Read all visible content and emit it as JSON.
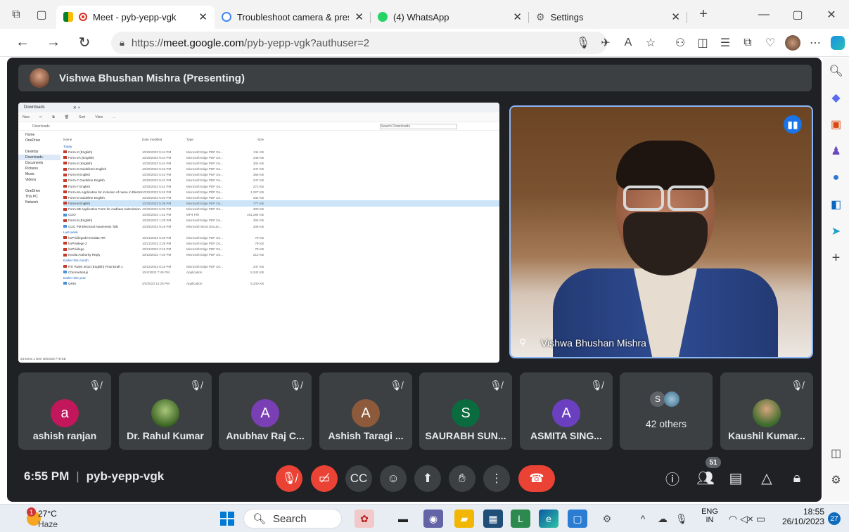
{
  "tabs": [
    {
      "title": "Meet - pyb-yepp-vgk",
      "active": true
    },
    {
      "title": "Troubleshoot camera & presenta",
      "active": false
    },
    {
      "title": "(4) WhatsApp",
      "active": false
    },
    {
      "title": "Settings",
      "active": false
    }
  ],
  "address": {
    "prefix": "https://",
    "host": "meet.google.com",
    "path": "/pyb-yepp-vgk?authuser=2"
  },
  "presenter_bar": {
    "label": "Vishwa Bhushan Mishra (Presenting)"
  },
  "shared_screen": {
    "window_title": "Downloads",
    "toolbar": [
      "New",
      "Sort",
      "View",
      "..."
    ],
    "breadcrumb": "Downloads",
    "search_placeholder": "Search Downloads",
    "sidebar": [
      "Home",
      "OneDrive",
      "",
      "Desktop",
      "Downloads",
      "Documents",
      "Pictures",
      "Music",
      "Videos",
      "",
      "OneDrive",
      "This PC",
      "Network"
    ],
    "columns": [
      "Name",
      "Date modified",
      "Type",
      "Size"
    ],
    "rows": [
      {
        "group": "Today"
      },
      {
        "name": "Form-2 (English)",
        "date": "10/26/2023 5:44 PM",
        "type": "Microsoft Edge PDF Do...",
        "size": "311 KB"
      },
      {
        "name": "Form-2A (English)",
        "date": "10/26/2023 5:44 PM",
        "type": "Microsoft Edge PDF Do...",
        "size": "345 KB"
      },
      {
        "name": "Form-2 (English)",
        "date": "10/26/2023 5:44 PM",
        "type": "Microsoft Edge PDF Do...",
        "size": "304 KB"
      },
      {
        "name": "Form-8 Guidelines English",
        "date": "10/26/2023 5:43 PM",
        "type": "Microsoft Edge PDF Do...",
        "size": "247 KB"
      },
      {
        "name": "Form-8 English",
        "date": "10/26/2023 5:43 PM",
        "type": "Microsoft Edge PDF Do...",
        "size": "356 KB"
      },
      {
        "name": "Form-7 Guideline English",
        "date": "10/26/2023 5:42 PM",
        "type": "Microsoft Edge PDF Do...",
        "size": "247 KB"
      },
      {
        "name": "Form-7 English",
        "date": "10/26/2023 5:42 PM",
        "type": "Microsoft Edge PDF Do...",
        "size": "272 KB"
      },
      {
        "name": "Form-6A Application for inclusion of name in Electora...",
        "date": "10/26/2023 5:42 PM",
        "type": "Microsoft Edge PDF Do...",
        "size": "1,327 KB"
      },
      {
        "name": "Form-6 Guideline English",
        "date": "10/26/2023 5:40 PM",
        "type": "Microsoft Edge PDF Do...",
        "size": "332 KB"
      },
      {
        "name": "Form-6 English",
        "date": "10/26/2023 5:39 PM",
        "type": "Microsoft Edge PDF Do...",
        "size": "777 KB",
        "selected": true
      },
      {
        "name": "Form-6B Application Form for Aadhaar submission",
        "date": "10/26/2023 5:33 PM",
        "type": "Microsoft Edge PDF Do...",
        "size": "300 KB"
      },
      {
        "name": "CLIO",
        "date": "10/26/2023 1:42 PM",
        "type": "MP4 File",
        "size": "161,294 KB"
      },
      {
        "name": "Form-6 (English)",
        "date": "10/26/2023 1:29 PM",
        "type": "Microsoft Edge PDF Do...",
        "size": "302 KB"
      },
      {
        "name": "CLIC PM Electoral Awareness Talk",
        "date": "10/26/2023 9:16 PM",
        "type": "Microsoft Word Docum...",
        "size": "208 KB"
      },
      {
        "group": "Last week"
      },
      {
        "name": "hoPrivileged/Arvind&c RR",
        "date": "10/21/2023 5:28 PM",
        "type": "Microsoft Edge PDF Do...",
        "size": "79 KB"
      },
      {
        "name": "hoPrivilege 2",
        "date": "10/21/2023 2:28 PM",
        "type": "Microsoft Edge PDF Do...",
        "size": "79 KB"
      },
      {
        "name": "hoPrivilege",
        "date": "10/21/2023 2:15 PM",
        "type": "Microsoft Edge PDF Do...",
        "size": "79 KB"
      },
      {
        "name": "Kerala Authority Reply",
        "date": "10/19/2023 7:40 PM",
        "type": "Microsoft Edge PDF Do...",
        "size": "212 KB"
      },
      {
        "group": "Earlier this month"
      },
      {
        "name": "RTI Rules 2012 (English) Final Draft 1",
        "date": "10/12/2023 6:18 PM",
        "type": "Microsoft Edge PDF Do...",
        "size": "247 KB"
      },
      {
        "name": "ChromeSetup",
        "date": "10/4/2023 7:45 PM",
        "type": "Application",
        "size": "5,342 KB"
      },
      {
        "group": "Earlier this year"
      },
      {
        "name": "QHIS",
        "date": "2/3/2023 12:25 PM",
        "type": "Application",
        "size": "5,340 KB"
      }
    ],
    "status": "23 items    1 item selected  776 KB"
  },
  "camera": {
    "name": "Vishwa Bhushan Mishra"
  },
  "participants": [
    {
      "name": "ashish ranjan",
      "initial": "a",
      "color": "#c2185b",
      "photo": false
    },
    {
      "name": "Dr. Rahul Kumar",
      "initial": "",
      "color": "#6a8f3a",
      "photo": true
    },
    {
      "name": "Anubhav Raj C...",
      "initial": "A",
      "color": "#7b3fb5",
      "photo": false
    },
    {
      "name": "Ashish Taragi ...",
      "initial": "A",
      "color": "#8d5a3b",
      "photo": false
    },
    {
      "name": "SAURABH SUN...",
      "initial": "S",
      "color": "#0a6b3f",
      "photo": false
    },
    {
      "name": "ASMITA SING...",
      "initial": "A",
      "color": "#6a3fc0",
      "photo": false
    }
  ],
  "others_tile": {
    "label": "42 others",
    "small_initial": "S"
  },
  "last_participant": {
    "name": "Kaushil Kumar..."
  },
  "meeting": {
    "time": "6:55 PM",
    "sep": "|",
    "code": "pyb-yepp-vgk",
    "people_count": "51"
  },
  "taskbar": {
    "temp": "27°C",
    "weather": "Haze",
    "weather_badge": "1",
    "search": "Search",
    "lang": "ENG",
    "region": "IN",
    "clock": "18:55",
    "date": "26/10/2023",
    "notif": "27"
  },
  "colors": {
    "meet_bg": "#202124",
    "tile_bg": "#3c4043",
    "red": "#ea4335",
    "accent": "#8ab4f8"
  }
}
